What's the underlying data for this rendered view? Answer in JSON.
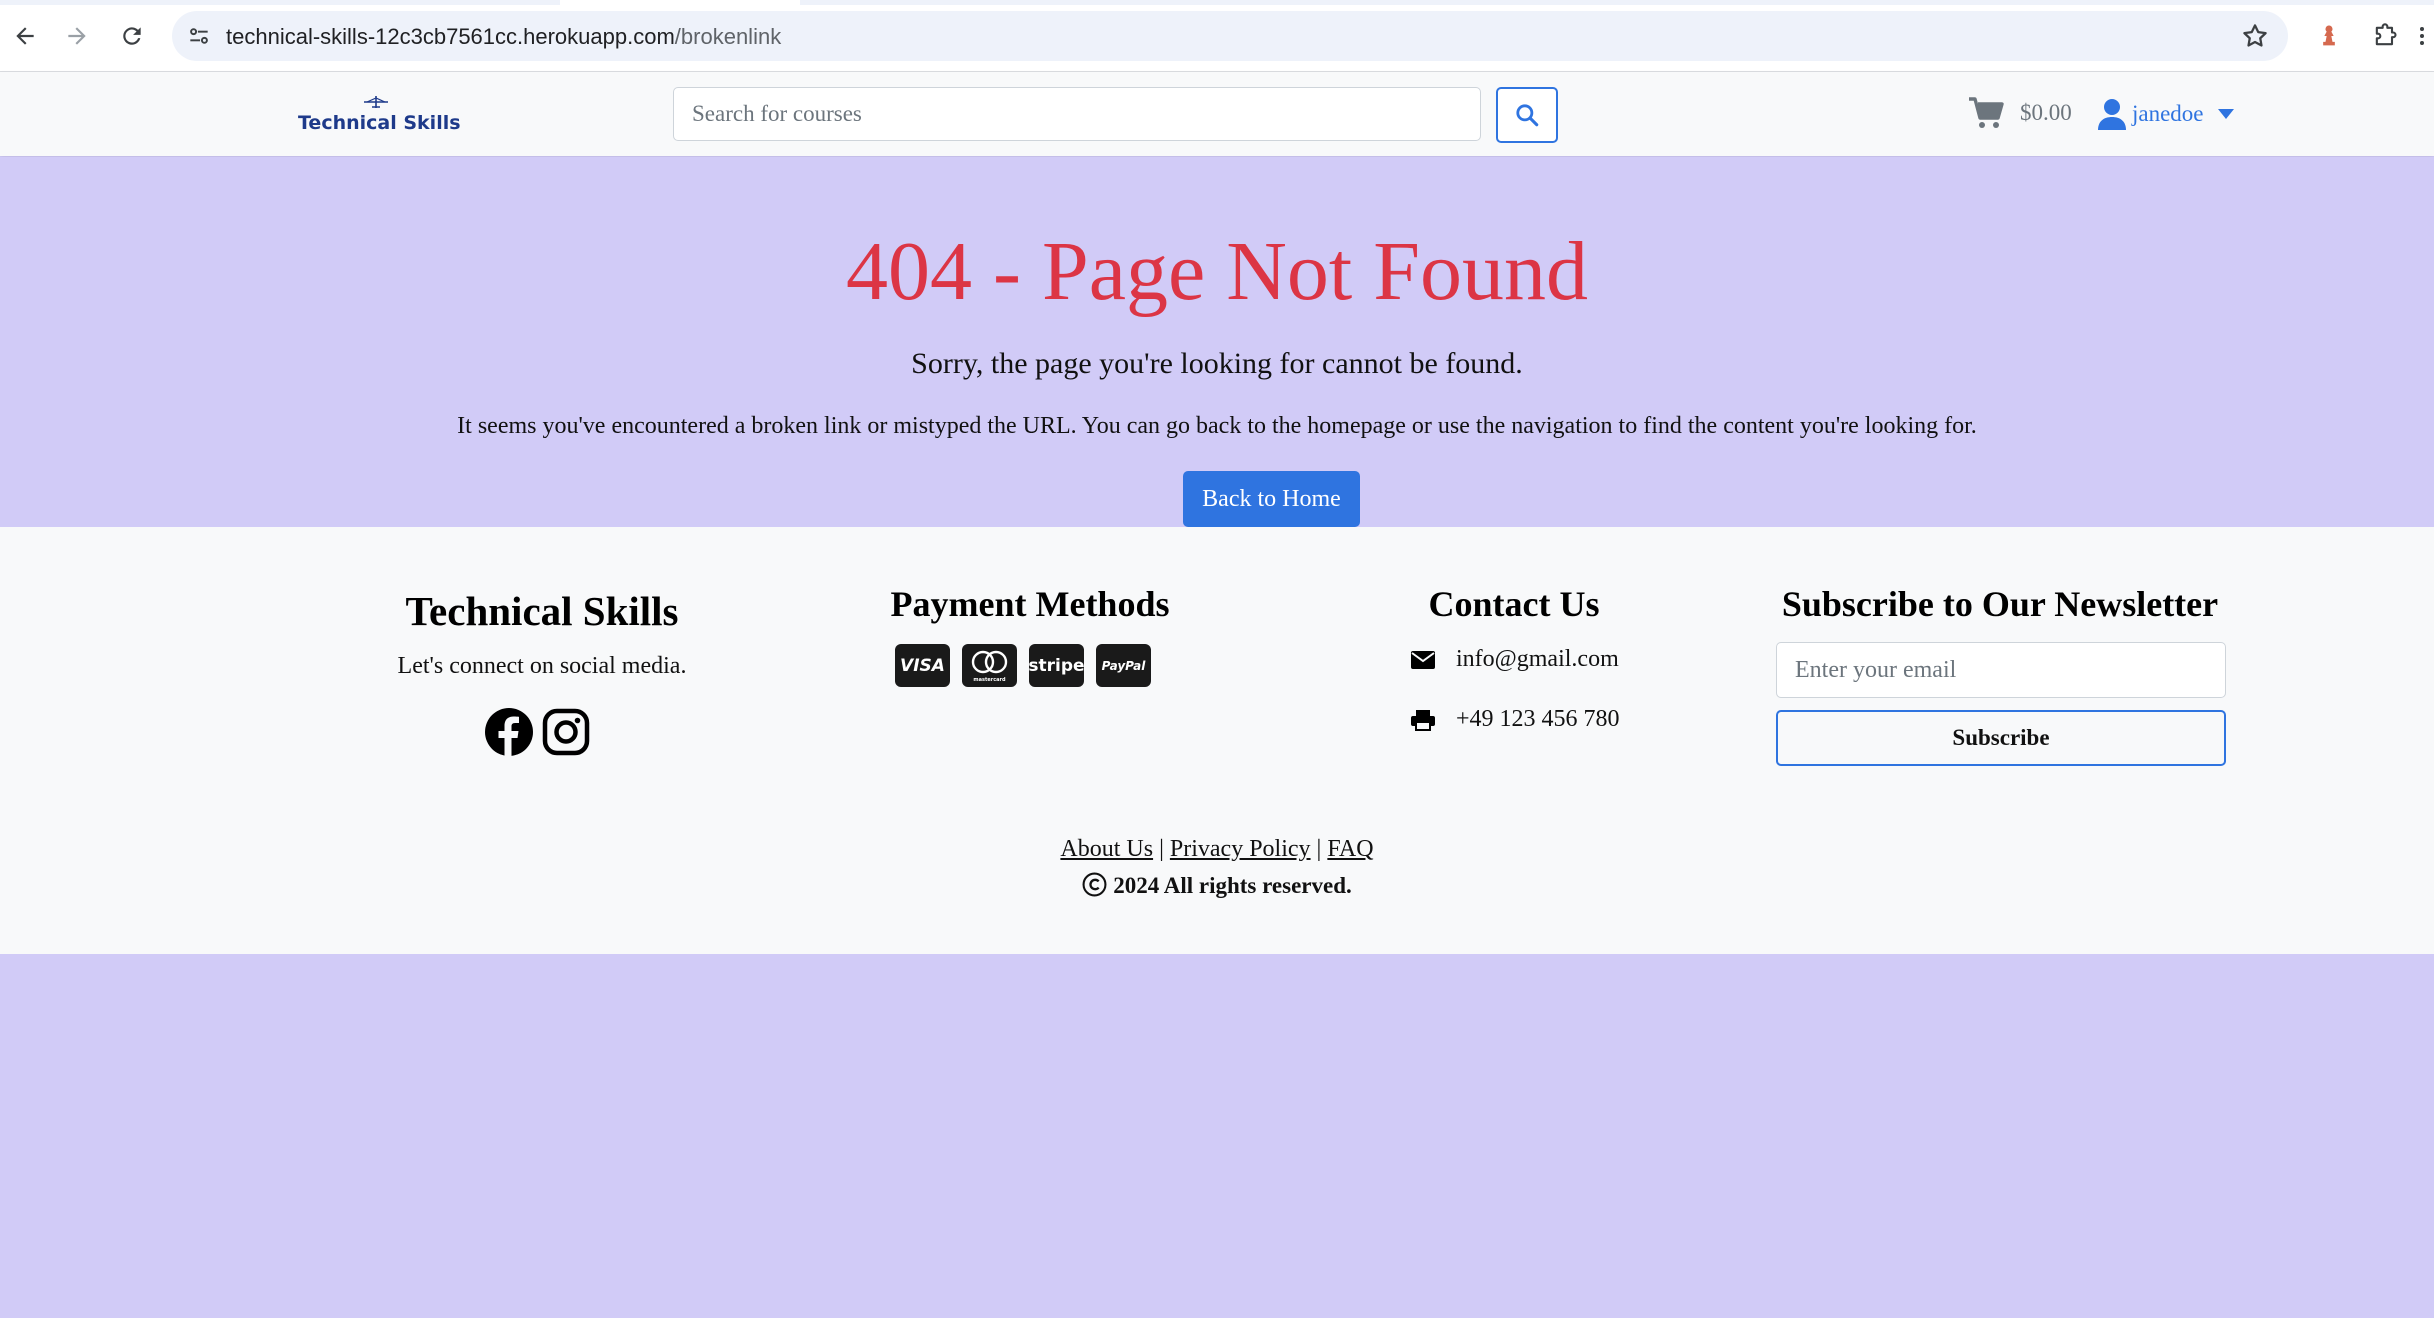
{
  "browser": {
    "url_host": "technical-skills-12c3cb7561cc.herokuapp.com",
    "url_path": "/brokenlink"
  },
  "navbar": {
    "brand": "Technical Skills",
    "search_placeholder": "Search for courses",
    "cart_total": "$0.00",
    "username": "janedoe"
  },
  "hero": {
    "title": "404 - Page Not Found",
    "lead": "Sorry, the page you're looking for cannot be found.",
    "description": "It seems you've encountered a broken link or mistyped the URL. You can go back to the homepage or use the navigation to find the content you're looking for.",
    "button": "Back to Home"
  },
  "footer": {
    "brand": {
      "title": "Technical Skills",
      "subtitle": "Let's connect on social media.",
      "social": [
        "facebook-icon",
        "instagram-icon"
      ]
    },
    "payment": {
      "title": "Payment Methods",
      "methods": [
        "VISA",
        "mastercard",
        "stripe",
        "PayPal"
      ]
    },
    "contact": {
      "title": "Contact Us",
      "email": "info@gmail.com",
      "phone": "+49 123 456 780"
    },
    "newsletter": {
      "title": "Subscribe to Our Newsletter",
      "placeholder": "Enter your email",
      "button": "Subscribe"
    },
    "links": [
      "About Us",
      "Privacy Policy",
      "FAQ"
    ],
    "separator": "|",
    "copyright": "2024 All rights reserved."
  },
  "colors": {
    "page_background": "#d1cbf7",
    "primary": "#2f74e0",
    "error_title": "#dc3545",
    "brand_text": "#1e3a8a",
    "footer_background": "#f8f9fa"
  }
}
